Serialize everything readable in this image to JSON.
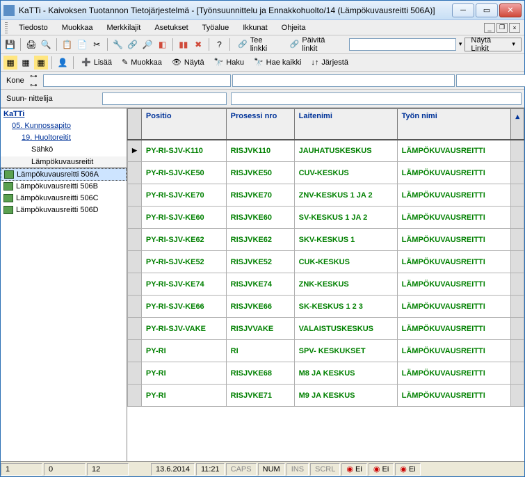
{
  "window": {
    "title": "KaTTi - Kaivoksen Tuotannon Tietojärjestelmä - [Työnsuunnittelu ja Ennakkohuolto/14 (Lämpökuvausreitti 506A)]"
  },
  "menubar": [
    "Tiedosto",
    "Muokkaa",
    "Merkkilajit",
    "Asetukset",
    "Työalue",
    "Ikkunat",
    "Ohjeita"
  ],
  "toolbar": {
    "tee_linkki": "Tee linkki",
    "paivita_linkit": "Päivitä linkit",
    "nayta_linkit": "Näytä Linkit"
  },
  "toolbar2": {
    "lisaa": "Lisää",
    "muokkaa": "Muokkaa",
    "nayta": "Näytä",
    "haku": "Haku",
    "hae_kaikki": "Hae kaikki",
    "jarjesta": "Järjestä"
  },
  "filters": {
    "kone_label": "Kone",
    "suunnittelija_label": "Suun- nittelija",
    "key_icon": "⊶ ⊶"
  },
  "tree": {
    "root": "KaTTi",
    "items": [
      {
        "label": "05. Kunnossapito",
        "indent": 2
      },
      {
        "label": "19. Huoltoreitit",
        "indent": 3
      },
      {
        "label": "Sähkö",
        "indent": 4
      },
      {
        "label": "Lämpökuvausreitit",
        "indent": 4
      }
    ],
    "leaves": [
      {
        "label": "Lämpökuvausreitti 506A",
        "selected": true
      },
      {
        "label": "Lämpökuvausreitti 506B",
        "selected": false
      },
      {
        "label": "Lämpökuvausreitti 506C",
        "selected": false
      },
      {
        "label": "Lämpökuvausreitti 506D",
        "selected": false
      }
    ]
  },
  "grid": {
    "headers": [
      "Positio",
      "Prosessi nro",
      "Laitenimi",
      "Työn nimi"
    ],
    "rows": [
      {
        "positio": "PY-RI-SJV-K110",
        "prosessi": "RISJVK110",
        "laitenimi": "JAUHATUSKESKUS",
        "tyo": "LÄMPÖKUVAUSREITTI",
        "current": true
      },
      {
        "positio": "PY-RI-SJV-KE50",
        "prosessi": "RISJVKE50",
        "laitenimi": "CUV-KESKUS",
        "tyo": "LÄMPÖKUVAUSREITTI"
      },
      {
        "positio": "PY-RI-SJV-KE70",
        "prosessi": "RISJVKE70",
        "laitenimi": "ZNV-KESKUS 1 JA 2",
        "tyo": "LÄMPÖKUVAUSREITTI"
      },
      {
        "positio": "PY-RI-SJV-KE60",
        "prosessi": "RISJVKE60",
        "laitenimi": "SV-KESKUS 1 JA 2",
        "tyo": "LÄMPÖKUVAUSREITTI"
      },
      {
        "positio": "PY-RI-SJV-KE62",
        "prosessi": "RISJVKE62",
        "laitenimi": "SKV-KESKUS 1",
        "tyo": "LÄMPÖKUVAUSREITTI"
      },
      {
        "positio": "PY-RI-SJV-KE52",
        "prosessi": "RISJVKE52",
        "laitenimi": "CUK-KESKUS",
        "tyo": "LÄMPÖKUVAUSREITTI"
      },
      {
        "positio": "PY-RI-SJV-KE74",
        "prosessi": "RISJVKE74",
        "laitenimi": "ZNK-KESKUS",
        "tyo": "LÄMPÖKUVAUSREITTI"
      },
      {
        "positio": "PY-RI-SJV-KE66",
        "prosessi": "RISJVKE66",
        "laitenimi": "SK-KESKUS 1 2 3",
        "tyo": "LÄMPÖKUVAUSREITTI"
      },
      {
        "positio": "PY-RI-SJV-VAKE",
        "prosessi": "RISJVVAKE",
        "laitenimi": "VALAISTUSKESKUS",
        "tyo": "LÄMPÖKUVAUSREITTI"
      },
      {
        "positio": "PY-RI",
        "prosessi": "RI",
        "laitenimi": "SPV- KESKUKSET",
        "tyo": "LÄMPÖKUVAUSREITTI"
      },
      {
        "positio": "PY-RI",
        "prosessi": "RISJVKE68",
        "laitenimi": "M8 JA KESKUS",
        "tyo": "LÄMPÖKUVAUSREITTI"
      },
      {
        "positio": "PY-RI",
        "prosessi": "RISJVKE71",
        "laitenimi": "M9 JA KESKUS",
        "tyo": "LÄMPÖKUVAUSREITTI"
      }
    ]
  },
  "statusbar": {
    "pos1": "1",
    "pos2": "0",
    "pos3": "12",
    "date": "13.6.2014",
    "time": "11:21",
    "caps": "CAPS",
    "num": "NUM",
    "ins": "INS",
    "scrl": "SCRL",
    "ei1": "Ei",
    "ei2": "Ei",
    "ei3": "Ei"
  }
}
